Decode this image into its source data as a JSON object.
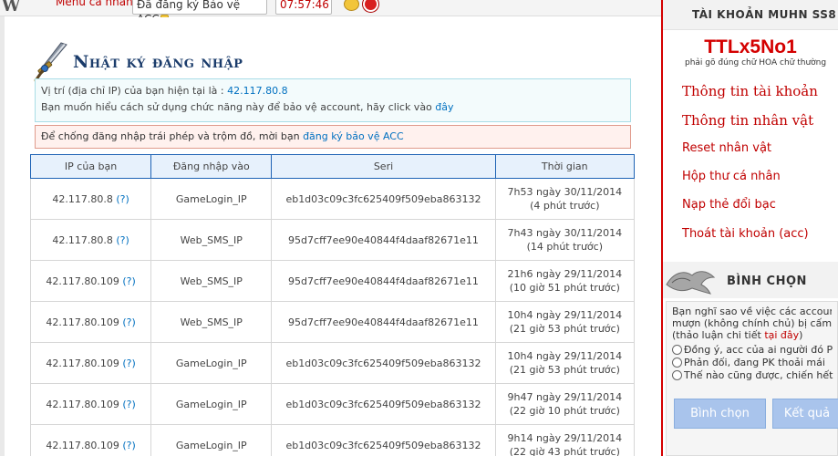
{
  "topbar": {
    "logo": "W",
    "menu_label": "Menu cá nhân",
    "acc_status": "Đã đăng ký Bảo vệ ACC",
    "clock": "07:57:46",
    "icons": [
      "smiley-icon",
      "notification-icon"
    ]
  },
  "page": {
    "title": "Nhật ký đăng nhập",
    "location_text": "Vị trí (địa chỉ IP) của bạn hiện tại là : ",
    "current_ip": "42.117.80.8",
    "help_text": "Bạn muốn hiểu cách sử dụng chức năng này để bảo vệ account, hãy click vào ",
    "help_link": "đây",
    "warning_text": "Để chống đăng nhập trái phép và trộm đồ, mời bạn ",
    "warning_link": "đăng ký bảo vệ ACC"
  },
  "table": {
    "headers": [
      "IP của bạn",
      "Đăng nhập vào",
      "Seri",
      "Thời gian"
    ],
    "rows": [
      {
        "ip": "42.117.80.8",
        "q": "(?)",
        "target": "GameLogin_IP",
        "seri": "eb1d03c09c3fc625409f509eba863132",
        "time": "7h53 ngày 30/11/2014",
        "ago": "(4 phút trước)"
      },
      {
        "ip": "42.117.80.8",
        "q": "(?)",
        "target": "Web_SMS_IP",
        "seri": "95d7cff7ee90e40844f4daaf82671e11",
        "time": "7h43 ngày 30/11/2014",
        "ago": "(14 phút trước)"
      },
      {
        "ip": "42.117.80.109",
        "q": "(?)",
        "target": "Web_SMS_IP",
        "seri": "95d7cff7ee90e40844f4daaf82671e11",
        "time": "21h6 ngày 29/11/2014",
        "ago": "(10 giờ 51 phút trước)"
      },
      {
        "ip": "42.117.80.109",
        "q": "(?)",
        "target": "Web_SMS_IP",
        "seri": "95d7cff7ee90e40844f4daaf82671e11",
        "time": "10h4 ngày 29/11/2014",
        "ago": "(21 giờ 53 phút trước)"
      },
      {
        "ip": "42.117.80.109",
        "q": "(?)",
        "target": "GameLogin_IP",
        "seri": "eb1d03c09c3fc625409f509eba863132",
        "time": "10h4 ngày 29/11/2014",
        "ago": "(21 giờ 53 phút trước)"
      },
      {
        "ip": "42.117.80.109",
        "q": "(?)",
        "target": "GameLogin_IP",
        "seri": "eb1d03c09c3fc625409f509eba863132",
        "time": "9h47 ngày 29/11/2014",
        "ago": "(22 giờ 10 phút trước)"
      },
      {
        "ip": "42.117.80.109",
        "q": "(?)",
        "target": "GameLogin_IP",
        "seri": "eb1d03c09c3fc625409f509eba863132",
        "time": "9h14 ngày 29/11/2014",
        "ago": "(22 giờ 43 phút trước)"
      }
    ]
  },
  "sidebar": {
    "header": "TÀI KHOẢN MUHN SS8",
    "username": "TTLx5No1",
    "username_hint": "phải gõ đúng chữ HOA chữ thường",
    "links": [
      {
        "label": "Thông tin tài khoản"
      },
      {
        "label": "Thông tin nhân vật"
      },
      {
        "label": "Reset nhân vật"
      },
      {
        "label": "Hộp thư cá nhân"
      },
      {
        "label": "Nạp thẻ đổi bạc"
      },
      {
        "label": "Thoát tài khoản (acc)"
      }
    ],
    "vote": {
      "header": "BÌNH CHỌN",
      "question_line1": "Bạn nghĩ sao về việc các account",
      "question_line2": "mượn (không chính chủ) bị cấm l",
      "question_line3_a": "(thảo luận chi tiết ",
      "question_link": "tại đây",
      "question_line3_b": ")",
      "options": [
        "Đồng ý, acc của ai người đó P",
        "Phản đối, đang PK thoải mái",
        "Thế nào cũng được, chiến hết"
      ],
      "vote_button": "Bình chọn",
      "result_button": "Kết quả"
    }
  },
  "colors": {
    "accent_red": "#d40000",
    "link_blue": "#0070c0",
    "title_navy": "#1b3c6b",
    "table_border": "#1e63b5",
    "table_header_bg": "#e7f1fc"
  }
}
